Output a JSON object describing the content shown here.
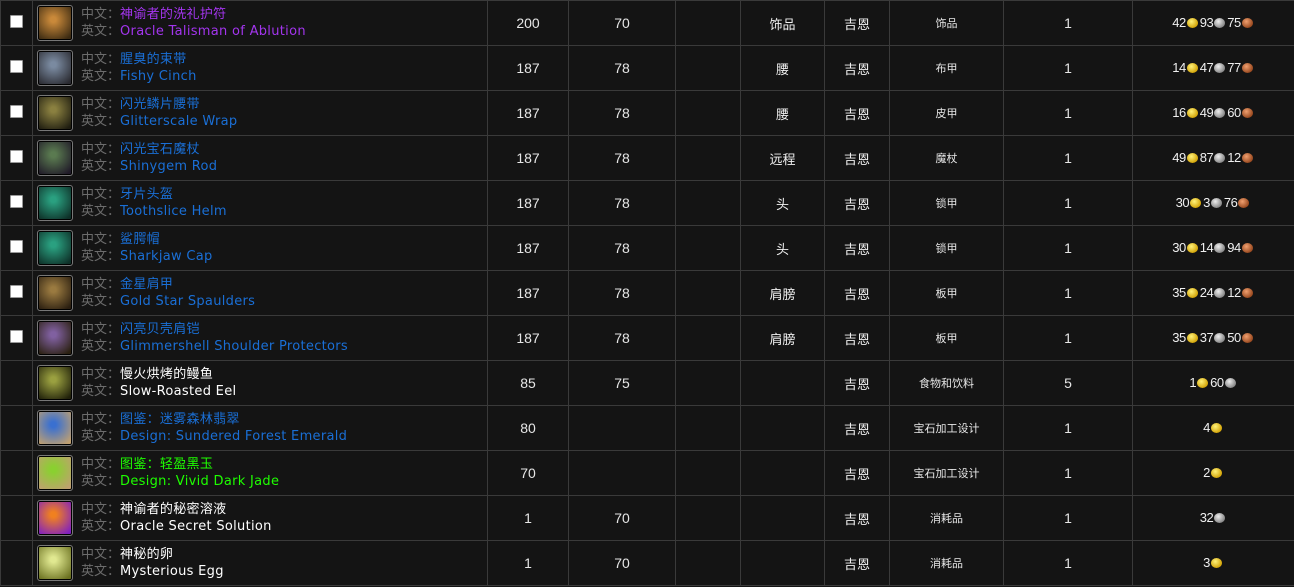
{
  "labels": {
    "cn": "中文：",
    "en": "英文："
  },
  "colors": {
    "epic": "#a335ee",
    "rare": "#1a6fd6",
    "uncommon": "#1eff00",
    "common": "#ffffff",
    "label": "#6c6c6c",
    "border": "#3a3a3a",
    "background": "#141414"
  },
  "rows": [
    {
      "checkbox": true,
      "icon": "talisman-icon",
      "iconColors": [
        "#c9893a",
        "#3b2a12"
      ],
      "quality": "epic",
      "cn": "神谕者的洗礼护符",
      "en": "Oracle Talisman of Ablution",
      "item_level": "200",
      "req_level": "70",
      "extra": "",
      "slot": "饰品",
      "faction": "吉恩",
      "type": "饰品",
      "count": "1",
      "price": {
        "gold": "42",
        "silver": "93",
        "copper": "75"
      }
    },
    {
      "checkbox": true,
      "icon": "belt-icon",
      "iconColors": [
        "#7a8aa0",
        "#2a2a30"
      ],
      "quality": "rare",
      "cn": "腥臭的束带",
      "en": "Fishy Cinch",
      "item_level": "187",
      "req_level": "78",
      "extra": "",
      "slot": "腰",
      "faction": "吉恩",
      "type": "布甲",
      "count": "1",
      "price": {
        "gold": "14",
        "silver": "47",
        "copper": "77"
      }
    },
    {
      "checkbox": true,
      "icon": "wrap-belt-icon",
      "iconColors": [
        "#8a8040",
        "#1e1c10"
      ],
      "quality": "rare",
      "cn": "闪光鳞片腰带",
      "en": "Glitterscale Wrap",
      "item_level": "187",
      "req_level": "78",
      "extra": "",
      "slot": "腰",
      "faction": "吉恩",
      "type": "皮甲",
      "count": "1",
      "price": {
        "gold": "16",
        "silver": "49",
        "copper": "60"
      }
    },
    {
      "checkbox": true,
      "icon": "wand-icon",
      "iconColors": [
        "#5a7a50",
        "#201a28"
      ],
      "quality": "rare",
      "cn": "闪光宝石魔杖",
      "en": "Shinygem Rod",
      "item_level": "187",
      "req_level": "78",
      "extra": "",
      "slot": "远程",
      "faction": "吉恩",
      "type": "魔杖",
      "count": "1",
      "price": {
        "gold": "49",
        "silver": "87",
        "copper": "12"
      }
    },
    {
      "checkbox": true,
      "icon": "helm-icon",
      "iconColors": [
        "#2aa080",
        "#0e3028"
      ],
      "quality": "rare",
      "cn": "牙片头盔",
      "en": "Toothslice Helm",
      "item_level": "187",
      "req_level": "78",
      "extra": "",
      "slot": "头",
      "faction": "吉恩",
      "type": "锁甲",
      "count": "1",
      "price": {
        "gold": "30",
        "silver": "3",
        "copper": "76"
      }
    },
    {
      "checkbox": true,
      "icon": "helm-icon",
      "iconColors": [
        "#2aa080",
        "#0e3028"
      ],
      "quality": "rare",
      "cn": "鲨腭帽",
      "en": "Sharkjaw Cap",
      "item_level": "187",
      "req_level": "78",
      "extra": "",
      "slot": "头",
      "faction": "吉恩",
      "type": "锁甲",
      "count": "1",
      "price": {
        "gold": "30",
        "silver": "14",
        "copper": "94"
      }
    },
    {
      "checkbox": true,
      "icon": "shoulder-icon",
      "iconColors": [
        "#9a7a40",
        "#2a1e10"
      ],
      "quality": "rare",
      "cn": "金星肩甲",
      "en": "Gold Star Spaulders",
      "item_level": "187",
      "req_level": "78",
      "extra": "",
      "slot": "肩膀",
      "faction": "吉恩",
      "type": "板甲",
      "count": "1",
      "price": {
        "gold": "35",
        "silver": "24",
        "copper": "12"
      }
    },
    {
      "checkbox": true,
      "icon": "shoulder-icon",
      "iconColors": [
        "#8060a0",
        "#2a2010"
      ],
      "quality": "rare",
      "cn": "闪亮贝壳肩铠",
      "en": "Glimmershell Shoulder Protectors",
      "item_level": "187",
      "req_level": "78",
      "extra": "",
      "slot": "肩膀",
      "faction": "吉恩",
      "type": "板甲",
      "count": "1",
      "price": {
        "gold": "35",
        "silver": "37",
        "copper": "50"
      }
    },
    {
      "checkbox": false,
      "icon": "eel-icon",
      "iconColors": [
        "#9aa040",
        "#20200a"
      ],
      "quality": "common",
      "cn": "慢火烘烤的鳗鱼",
      "en": "Slow-Roasted Eel",
      "item_level": "85",
      "req_level": "75",
      "extra": "",
      "slot": "",
      "faction": "吉恩",
      "type": "食物和饮料",
      "count": "5",
      "price": {
        "gold": "1",
        "silver": "60",
        "copper": ""
      }
    },
    {
      "checkbox": false,
      "icon": "scroll-icon",
      "iconColors": [
        "#3a70d0",
        "#c0a070"
      ],
      "quality": "rare",
      "cn": "图鉴：迷雾森林翡翠",
      "en": "Design: Sundered Forest Emerald",
      "item_level": "80",
      "req_level": "",
      "extra": "",
      "slot": "",
      "faction": "吉恩",
      "type": "宝石加工设计",
      "count": "1",
      "price": {
        "gold": "4",
        "silver": "",
        "copper": ""
      }
    },
    {
      "checkbox": false,
      "icon": "scroll-icon",
      "iconColors": [
        "#8ad030",
        "#c0a070"
      ],
      "quality": "uncommon",
      "cn": "图鉴：轻盈黑玉",
      "en": "Design: Vivid Dark Jade",
      "item_level": "70",
      "req_level": "",
      "extra": "",
      "slot": "",
      "faction": "吉恩",
      "type": "宝石加工设计",
      "count": "1",
      "price": {
        "gold": "2",
        "silver": "",
        "copper": ""
      }
    },
    {
      "checkbox": false,
      "icon": "potion-icon",
      "iconColors": [
        "#f08020",
        "#8020c0"
      ],
      "quality": "common",
      "cn": "神谕者的秘密溶液",
      "en": "Oracle Secret Solution",
      "item_level": "1",
      "req_level": "70",
      "extra": "",
      "slot": "",
      "faction": "吉恩",
      "type": "消耗品",
      "count": "1",
      "price": {
        "gold": "",
        "silver": "32",
        "copper": ""
      }
    },
    {
      "checkbox": false,
      "icon": "egg-icon",
      "iconColors": [
        "#e0e890",
        "#6a7020"
      ],
      "quality": "common",
      "cn": "神秘的卵",
      "en": "Mysterious Egg",
      "item_level": "1",
      "req_level": "70",
      "extra": "",
      "slot": "",
      "faction": "吉恩",
      "type": "消耗品",
      "count": "1",
      "price": {
        "gold": "3",
        "silver": "",
        "copper": ""
      }
    }
  ]
}
